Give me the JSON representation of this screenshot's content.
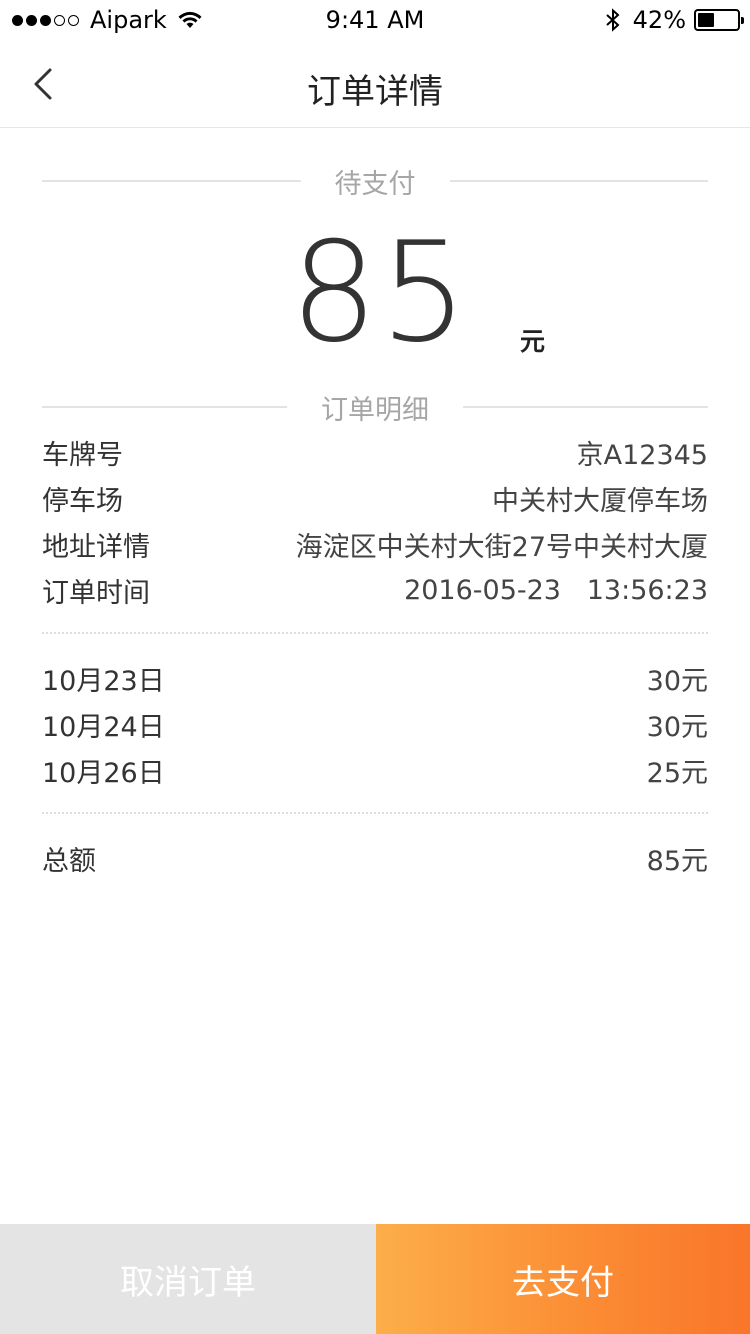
{
  "status_bar": {
    "carrier": "Aipark",
    "time": "9:41 AM",
    "battery": "42%",
    "battery_level": 0.42
  },
  "nav": {
    "title": "订单详情"
  },
  "status_section": {
    "label": "待支付"
  },
  "amount": {
    "value": "85",
    "unit": "元"
  },
  "detail_section": {
    "label": "订单明细",
    "rows": [
      {
        "key": "车牌号",
        "value": "京A12345"
      },
      {
        "key": "停车场",
        "value": "中关村大厦停车场"
      },
      {
        "key": "地址详情",
        "value": "海淀区中关村大街27号中关村大厦"
      },
      {
        "key": "订单时间",
        "value": "2016-05-23   13:56:23"
      }
    ]
  },
  "daily_fees": [
    {
      "date": "10月23日",
      "amount": "30元"
    },
    {
      "date": "10月24日",
      "amount": "30元"
    },
    {
      "date": "10月26日",
      "amount": "25元"
    }
  ],
  "total": {
    "label": "总额",
    "value": "85元"
  },
  "actions": {
    "cancel_label": "取消订单",
    "pay_label": "去支付"
  },
  "colors": {
    "pay_gradient_start": "#fcae4a",
    "pay_gradient_end": "#f9752a",
    "cancel_bg": "#e4e4e4"
  }
}
